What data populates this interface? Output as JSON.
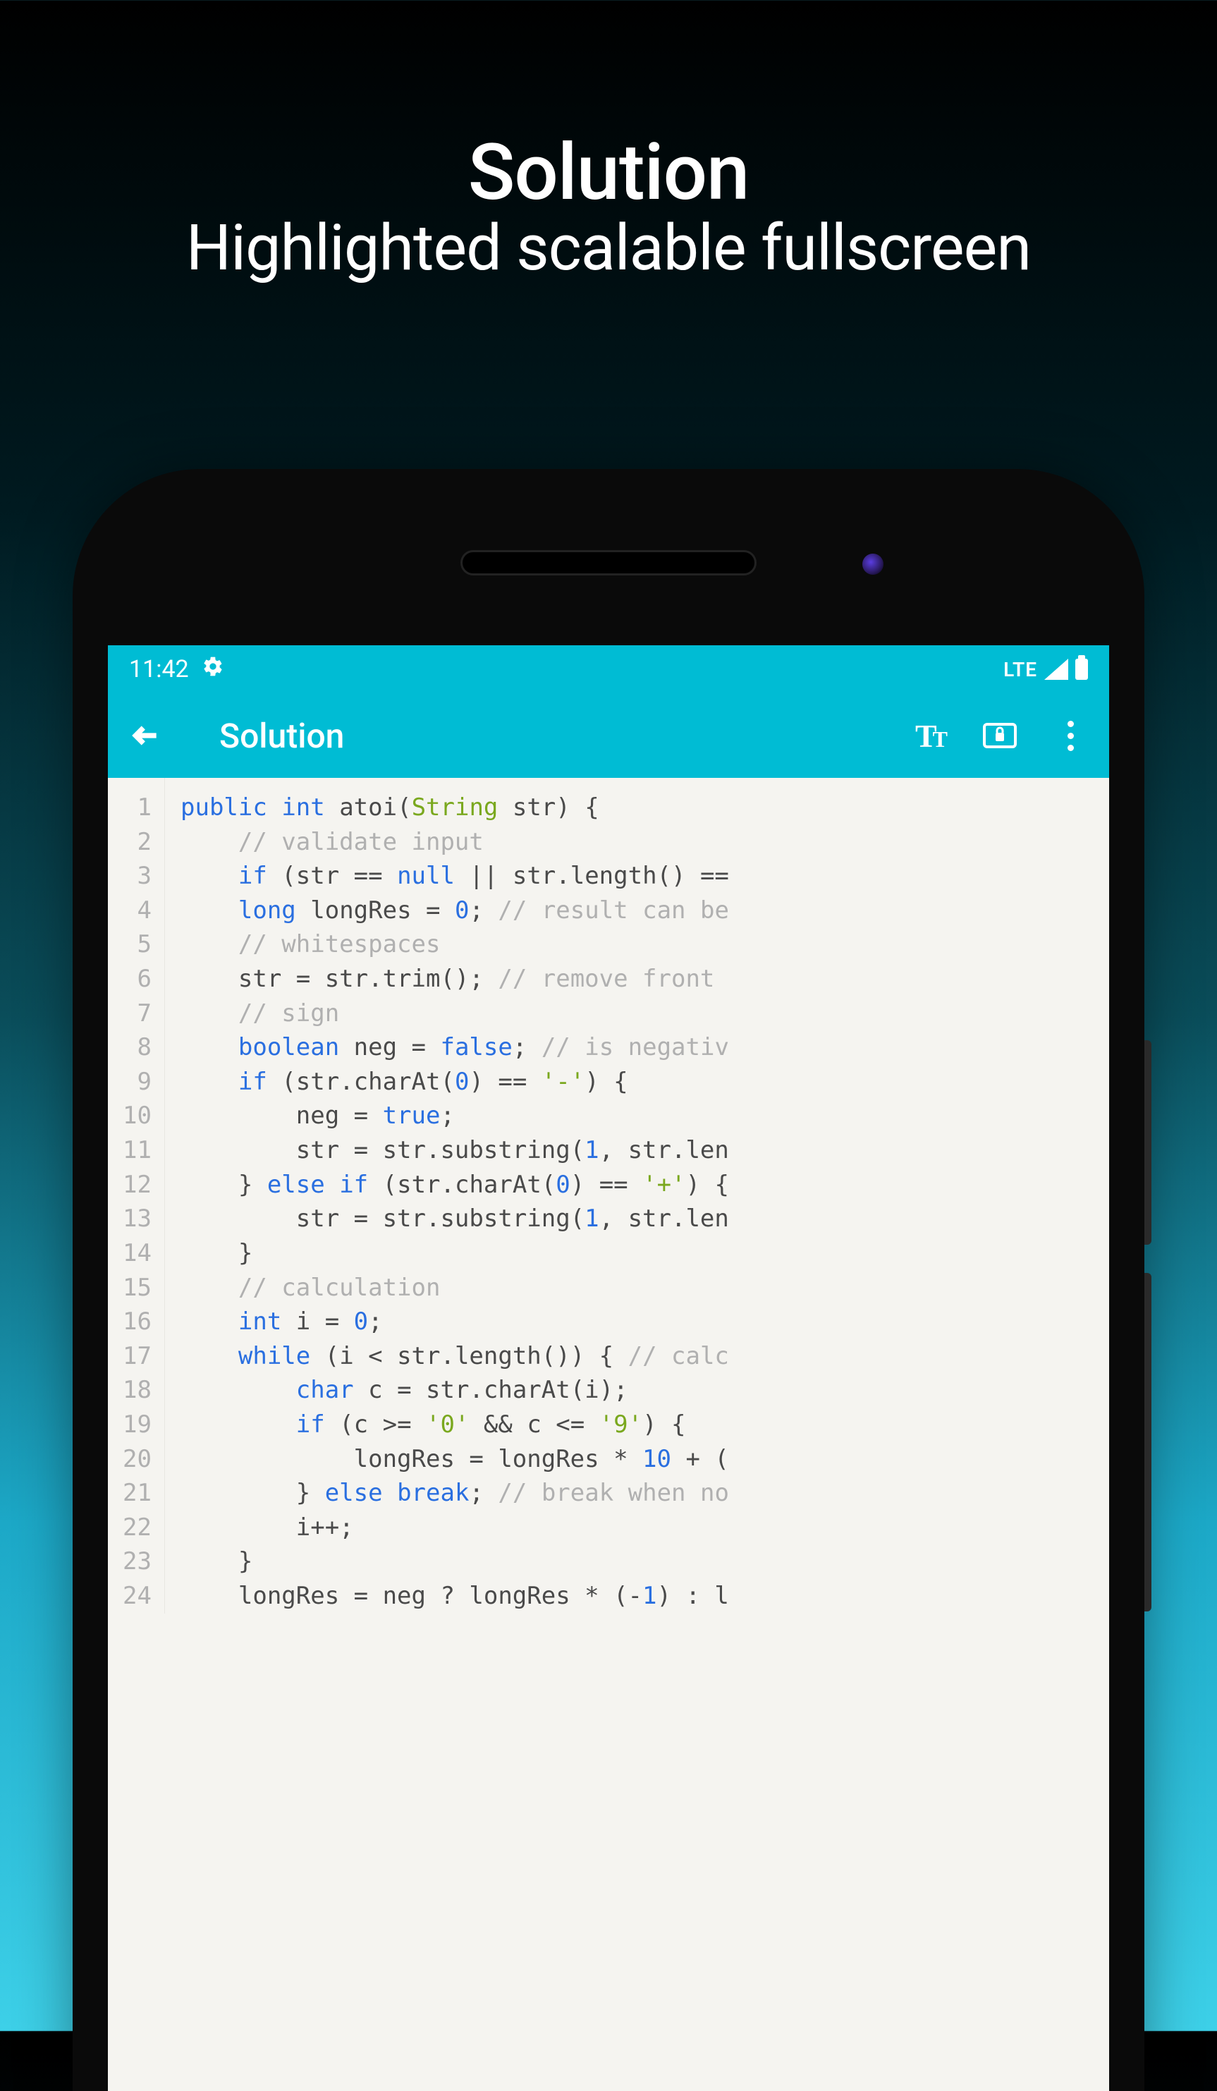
{
  "promo": {
    "title": "Solution",
    "subtitle": "Highlighted scalable fullscreen"
  },
  "status_bar": {
    "time": "11:42",
    "network": "LTE"
  },
  "app_bar": {
    "title": "Solution"
  },
  "code": {
    "lines": [
      {
        "n": 1,
        "tokens": [
          [
            "kw",
            "public"
          ],
          [
            "",
            ""
          ],
          [
            "",
            " "
          ],
          [
            "type",
            "int"
          ],
          [
            "",
            " atoi("
          ],
          [
            "str-type",
            "String"
          ],
          [
            "",
            " str) {"
          ]
        ]
      },
      {
        "n": 2,
        "tokens": [
          [
            "",
            "    "
          ],
          [
            "cmt",
            "// validate input"
          ]
        ]
      },
      {
        "n": 3,
        "tokens": [
          [
            "",
            "    "
          ],
          [
            "kw",
            "if"
          ],
          [
            "",
            " (str == "
          ],
          [
            "lit",
            "null"
          ],
          [
            "",
            " || str.length() =="
          ]
        ]
      },
      {
        "n": 4,
        "tokens": [
          [
            "",
            "    "
          ],
          [
            "type",
            "long"
          ],
          [
            "",
            " longRes = "
          ],
          [
            "lit",
            "0"
          ],
          [
            "",
            ";"
          ],
          [
            "",
            " "
          ],
          [
            "cmt",
            "// result can be"
          ]
        ]
      },
      {
        "n": 5,
        "tokens": [
          [
            "",
            "    "
          ],
          [
            "cmt",
            "// whitespaces"
          ]
        ]
      },
      {
        "n": 6,
        "tokens": [
          [
            "",
            "    str = str.trim(); "
          ],
          [
            "cmt",
            "// remove front "
          ]
        ]
      },
      {
        "n": 7,
        "tokens": [
          [
            "",
            "    "
          ],
          [
            "cmt",
            "// sign"
          ]
        ]
      },
      {
        "n": 8,
        "tokens": [
          [
            "",
            "    "
          ],
          [
            "type",
            "boolean"
          ],
          [
            "",
            " neg = "
          ],
          [
            "lit",
            "false"
          ],
          [
            "",
            ";"
          ],
          [
            "",
            " "
          ],
          [
            "cmt",
            "// is negativ"
          ]
        ]
      },
      {
        "n": 9,
        "tokens": [
          [
            "",
            "    "
          ],
          [
            "kw",
            "if"
          ],
          [
            "",
            " (str.charAt("
          ],
          [
            "lit",
            "0"
          ],
          [
            "",
            ") == "
          ],
          [
            "strlit",
            "'-'"
          ],
          [
            "",
            ") {"
          ]
        ]
      },
      {
        "n": 10,
        "tokens": [
          [
            "",
            "        neg = "
          ],
          [
            "lit",
            "true"
          ],
          [
            "",
            ";"
          ]
        ]
      },
      {
        "n": 11,
        "tokens": [
          [
            "",
            "        str = str.substring("
          ],
          [
            "lit",
            "1"
          ],
          [
            "",
            ", str.len"
          ]
        ]
      },
      {
        "n": 12,
        "tokens": [
          [
            "",
            "    } "
          ],
          [
            "kw",
            "else"
          ],
          [
            "",
            " "
          ],
          [
            "kw",
            "if"
          ],
          [
            "",
            " (str.charAt("
          ],
          [
            "lit",
            "0"
          ],
          [
            "",
            ") == "
          ],
          [
            "strlit",
            "'+'"
          ],
          [
            "",
            ") {"
          ]
        ]
      },
      {
        "n": 13,
        "tokens": [
          [
            "",
            "        str = str.substring("
          ],
          [
            "lit",
            "1"
          ],
          [
            "",
            ", str.len"
          ]
        ]
      },
      {
        "n": 14,
        "tokens": [
          [
            "",
            "    }"
          ]
        ]
      },
      {
        "n": 15,
        "tokens": [
          [
            "",
            "    "
          ],
          [
            "cmt",
            "// calculation"
          ]
        ]
      },
      {
        "n": 16,
        "tokens": [
          [
            "",
            "    "
          ],
          [
            "type",
            "int"
          ],
          [
            "",
            " i = "
          ],
          [
            "lit",
            "0"
          ],
          [
            "",
            ";"
          ]
        ]
      },
      {
        "n": 17,
        "tokens": [
          [
            "",
            "    "
          ],
          [
            "kw",
            "while"
          ],
          [
            "",
            " (i < str.length()) { "
          ],
          [
            "cmt",
            "// calc"
          ]
        ]
      },
      {
        "n": 18,
        "tokens": [
          [
            "",
            "        "
          ],
          [
            "type",
            "char"
          ],
          [
            "",
            " c = str.charAt(i);"
          ]
        ]
      },
      {
        "n": 19,
        "tokens": [
          [
            "",
            "        "
          ],
          [
            "kw",
            "if"
          ],
          [
            "",
            " (c >= "
          ],
          [
            "strlit",
            "'0'"
          ],
          [
            "",
            " && c <= "
          ],
          [
            "strlit",
            "'9'"
          ],
          [
            "",
            ") {"
          ]
        ]
      },
      {
        "n": 20,
        "tokens": [
          [
            "",
            "            longRes = longRes * "
          ],
          [
            "lit",
            "10"
          ],
          [
            "",
            " + ("
          ]
        ]
      },
      {
        "n": 21,
        "tokens": [
          [
            "",
            "        } "
          ],
          [
            "kw",
            "else"
          ],
          [
            "",
            " "
          ],
          [
            "kw",
            "break"
          ],
          [
            "",
            ";"
          ],
          [
            "",
            " "
          ],
          [
            "cmt",
            "// break when no"
          ]
        ]
      },
      {
        "n": 22,
        "tokens": [
          [
            "",
            "        i++;"
          ]
        ]
      },
      {
        "n": 23,
        "tokens": [
          [
            "",
            "    }"
          ]
        ]
      },
      {
        "n": 24,
        "tokens": [
          [
            "",
            "    longRes = neg ? longRes * (-"
          ],
          [
            "lit",
            "1"
          ],
          [
            "",
            ") : l"
          ]
        ]
      }
    ]
  }
}
